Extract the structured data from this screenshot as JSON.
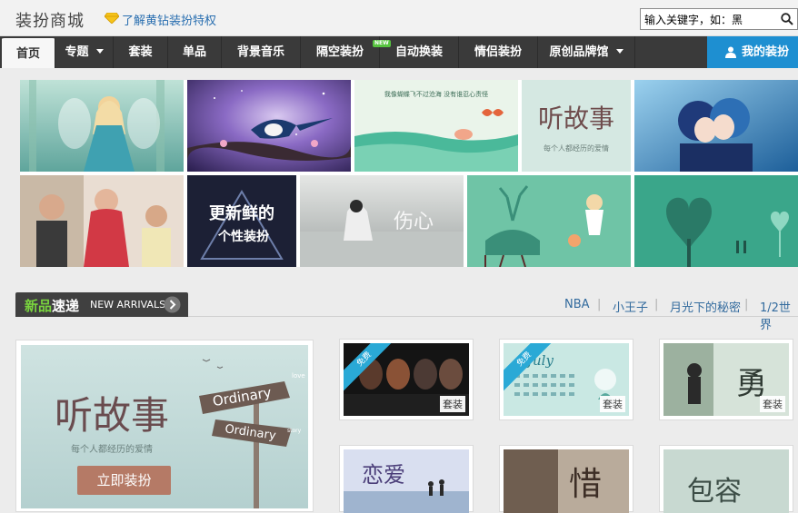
{
  "header": {
    "brand": "装扮商城",
    "privilege_link": "了解黄钻装扮特权",
    "search_value": "输入关键字，如：黑"
  },
  "nav": {
    "items": [
      {
        "label": "首页"
      },
      {
        "label": "专题"
      },
      {
        "label": "套装"
      },
      {
        "label": "单品"
      },
      {
        "label": "背景音乐"
      },
      {
        "label": "隔空装扮"
      },
      {
        "label": "自动换装"
      },
      {
        "label": "情侣装扮"
      },
      {
        "label": "原创品牌馆"
      }
    ],
    "new_badge": "NEW",
    "my_dress": "我的装扮"
  },
  "banner": {
    "tiles": [
      {
        "id": "fairy-girl",
        "color": "#7cc0b8"
      },
      {
        "id": "magpie-night",
        "color": "#7a5bb0"
      },
      {
        "id": "butterfly-lake",
        "color": "#d8ede0",
        "caption": "我像蝴蝶飞不过沧海  没有谁忍心责怪"
      },
      {
        "id": "story-love",
        "color": "#cde3dc",
        "title": "听故事",
        "subtitle": "每个人都经历的爱情"
      },
      {
        "id": "kiss-anime",
        "color": "#4f97c8"
      },
      {
        "id": "stars-photo",
        "color": "#d8c7b6"
      },
      {
        "id": "fresh-style",
        "color": "#1c2035",
        "title": "更新鲜的",
        "subtitle": "个性装扮"
      },
      {
        "id": "sad-heart",
        "color": "#cfd3d1",
        "title": "伤心"
      },
      {
        "id": "deer-girl",
        "color": "#68c1a2"
      },
      {
        "id": "heart-tree",
        "color": "#3aa68a"
      }
    ]
  },
  "section": {
    "title_a": "新品",
    "title_b": "速递",
    "title_en": "NEW ARRIVALS",
    "tags": [
      "NBA",
      "小王子",
      "月光下的秘密",
      "1/2世界"
    ]
  },
  "feature": {
    "title": "听故事",
    "subtitle": "每个人都经历的爱情",
    "sign_1": "Ordinary",
    "sign_2": "Ordinary",
    "sign_small_1": "love",
    "sign_small_2": "story",
    "cta": "立即装扮"
  },
  "cards": [
    {
      "label": "套装",
      "ribbon": "免费",
      "theme": "dark-faces"
    },
    {
      "label": "套装",
      "ribbon": "免费",
      "theme": "july-calendar",
      "month": "July"
    },
    {
      "label": "套装",
      "ribbon": "",
      "theme": "couple-brave",
      "glyph": "勇"
    },
    {
      "label": "",
      "ribbon": "",
      "theme": "love-beach",
      "glyph": "恋爱"
    },
    {
      "label": "",
      "ribbon": "",
      "theme": "cherish",
      "glyph": "惜"
    },
    {
      "label": "",
      "ribbon": "",
      "theme": "tolerance",
      "glyph": "包容"
    }
  ]
}
